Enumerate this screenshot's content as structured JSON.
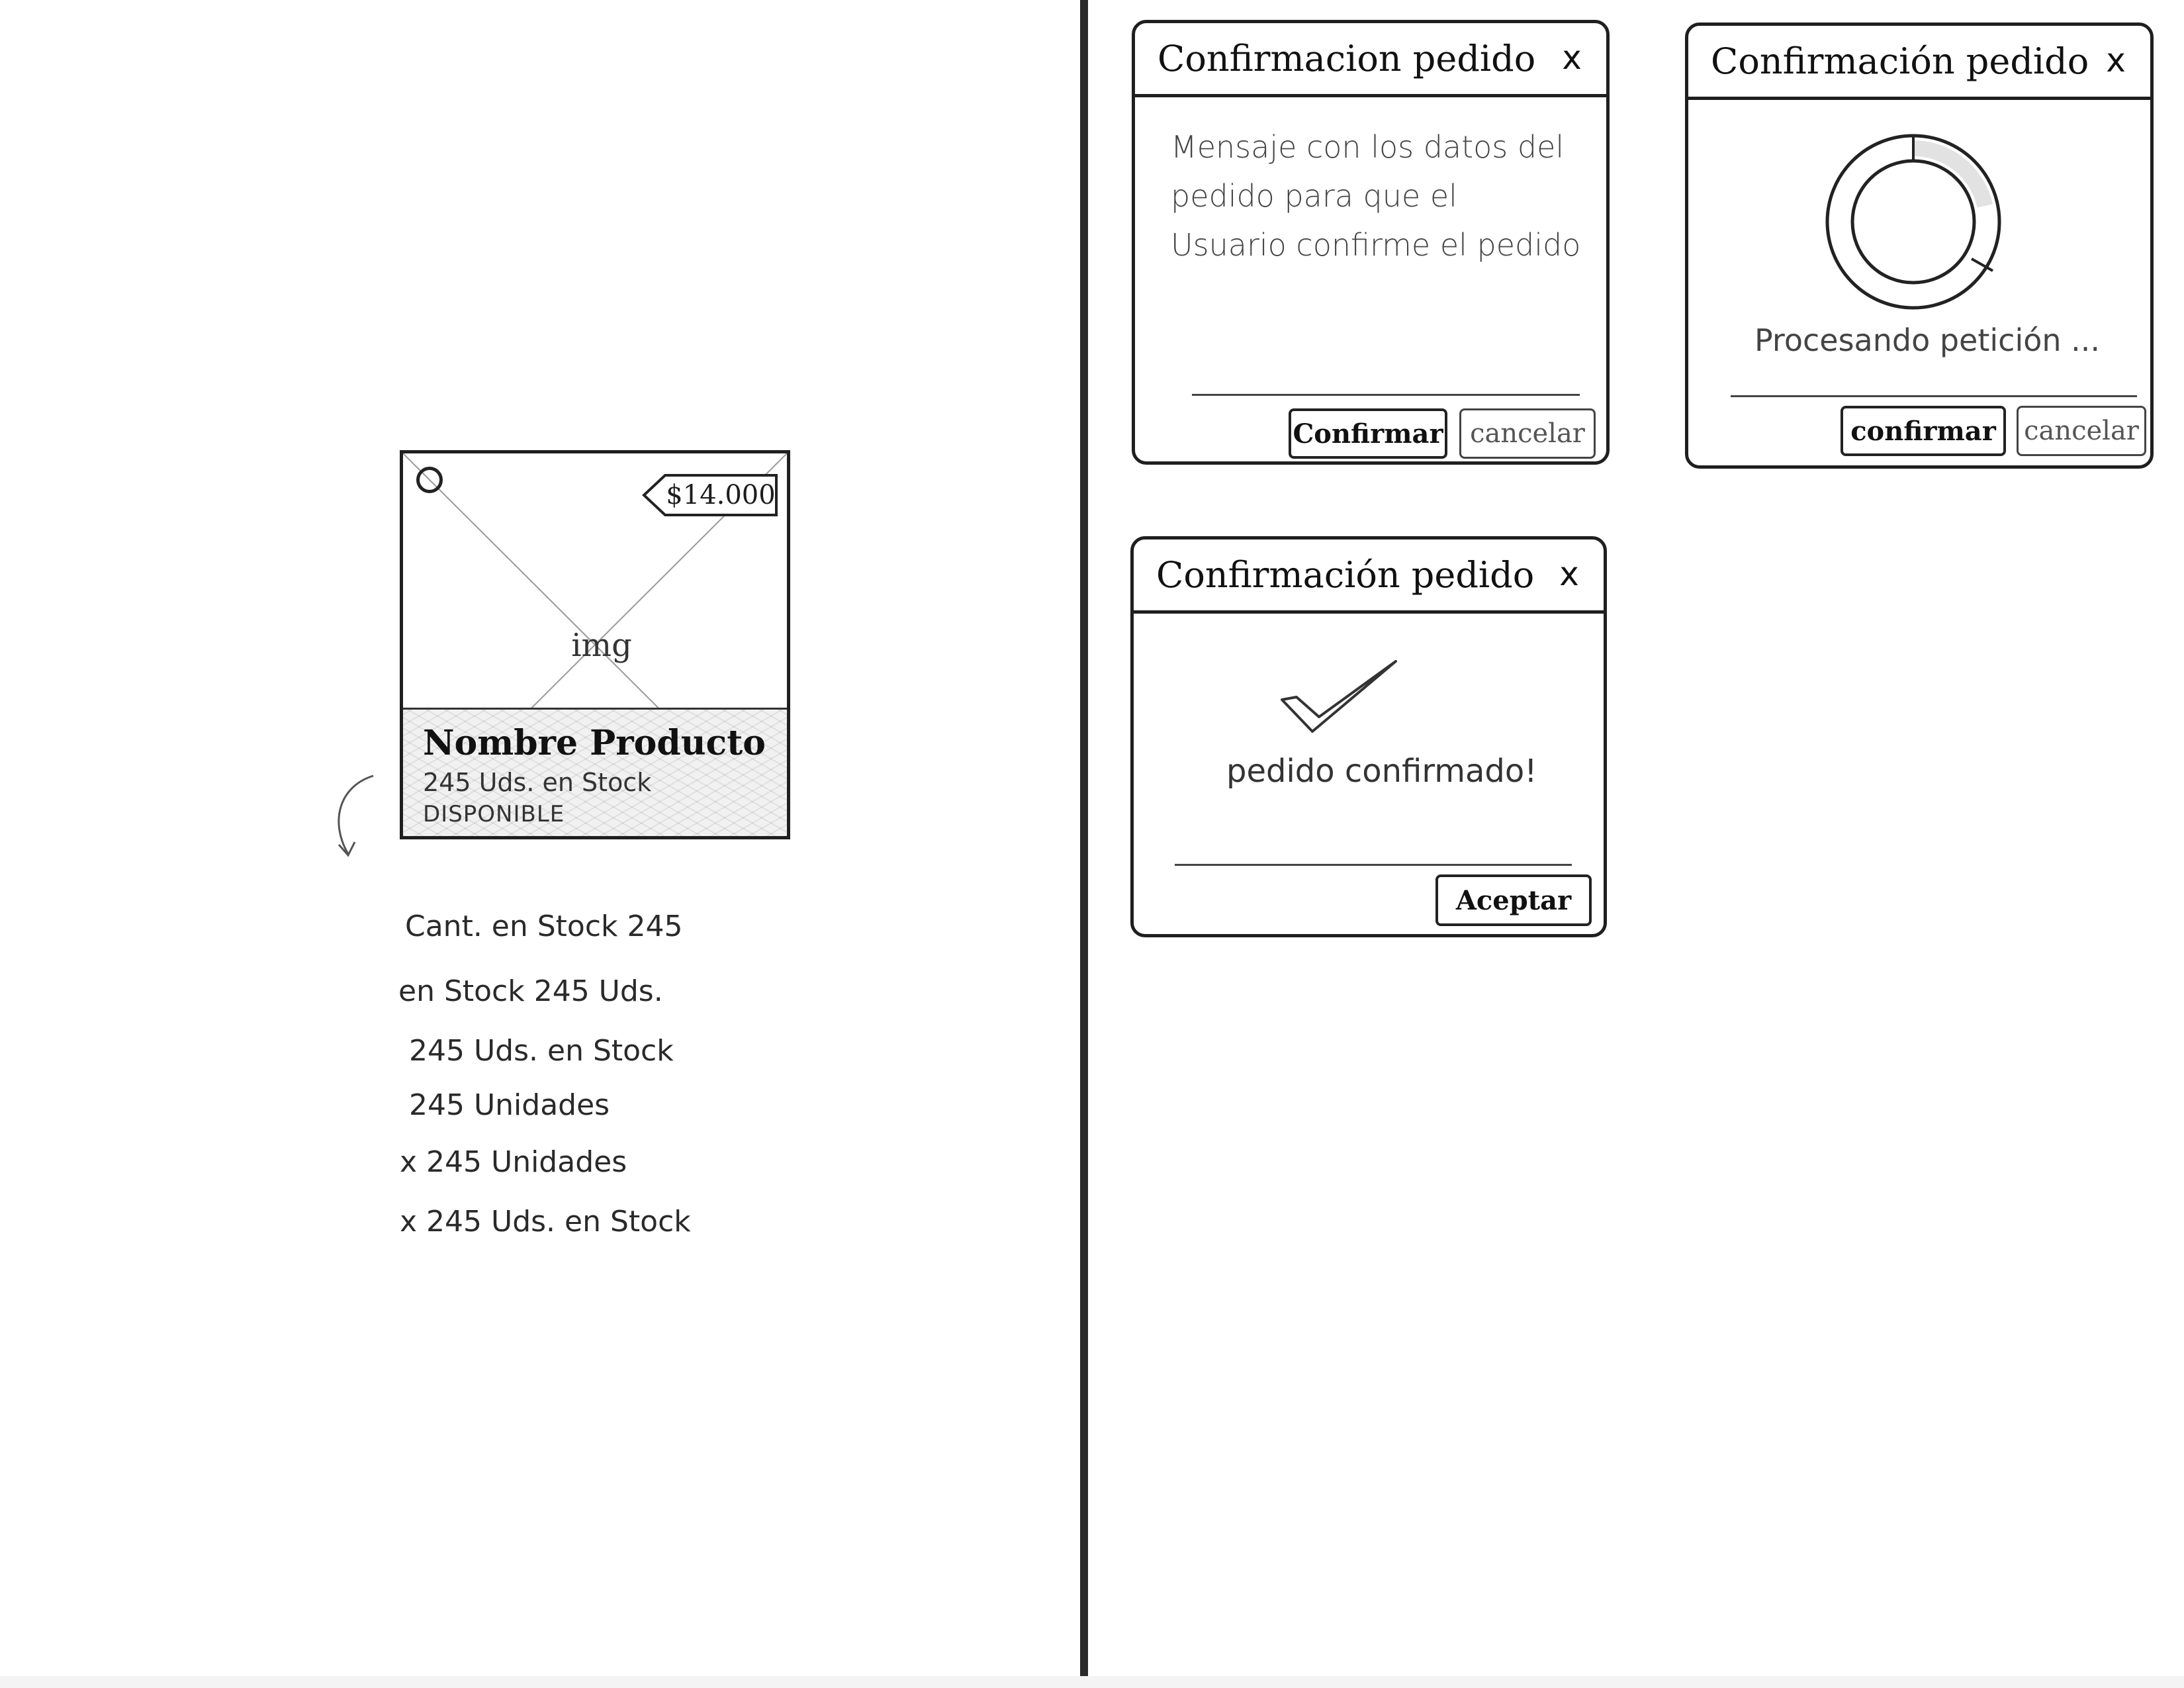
{
  "product_card": {
    "price": "$14.000",
    "image_label": "img",
    "name": "Nombre Producto",
    "stock": "245 Uds. en Stock",
    "status": "DISPONIBLE"
  },
  "stock_options": [
    "Cant. en Stock 245",
    "en Stock 245 Uds.",
    "245 Uds. en Stock",
    "245 Unidades",
    "x 245 Unidades",
    "x 245 Uds. en Stock"
  ],
  "dialog_confirm": {
    "title": "Confirmacion pedido",
    "close": "x",
    "message": "Mensaje con los datos del pedido para que el Usuario confirme el pedido",
    "confirm_label": "Confirmar",
    "cancel_label": "cancelar"
  },
  "dialog_processing": {
    "title": "Confirmación pedido",
    "close": "x",
    "message": "Procesando petición ...",
    "confirm_label": "confirmar",
    "cancel_label": "cancelar"
  },
  "dialog_success": {
    "title": "Confirmación pedido",
    "close": "x",
    "message": "pedido confirmado!",
    "accept_label": "Aceptar"
  }
}
